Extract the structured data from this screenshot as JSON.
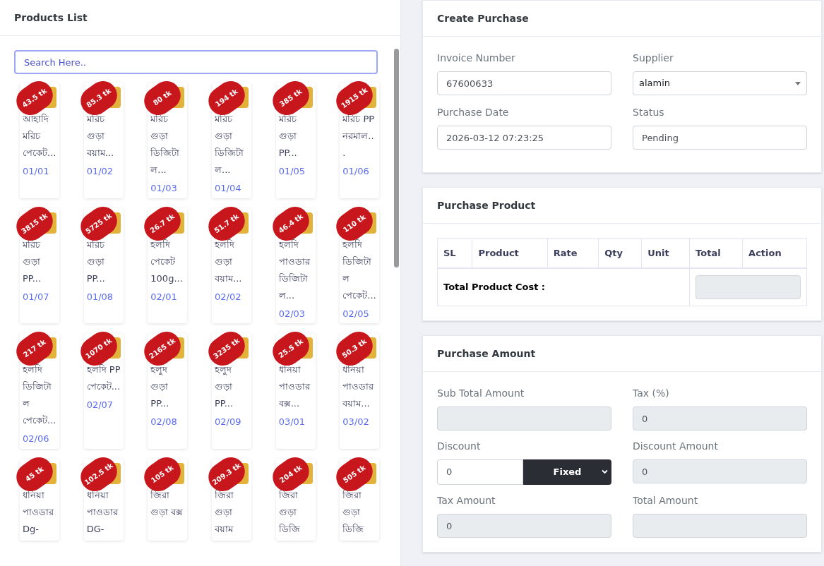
{
  "products_panel": {
    "title": "Products List",
    "search": {
      "placeholder": "Search Here.."
    },
    "products": [
      {
        "name": "আহাদি মরিচ পেকেট...",
        "price": "43.5 tk",
        "code": "01/01"
      },
      {
        "name": "মরিচ গুড়া বয়াম...",
        "price": "85.3 tk",
        "code": "01/02"
      },
      {
        "name": "মরিচ গুড়া ডিজিটাল...",
        "price": "80 tk",
        "code": "01/03"
      },
      {
        "name": "মরিচ গুড়া ডিজিটাল...",
        "price": "194 tk",
        "code": "01/04"
      },
      {
        "name": "মরিচ গুড়া PP...",
        "price": "385 tk",
        "code": "01/05"
      },
      {
        "name": "মরিচ PP নরমাল...",
        "price": "1915 tk",
        "code": "01/06"
      },
      {
        "name": "মরিচ গুড়া PP...",
        "price": "3815 tk",
        "code": "01/07"
      },
      {
        "name": "মরিচ গুড়া PP...",
        "price": "5725 tk",
        "code": "01/08"
      },
      {
        "name": "হলদি পেকেট 100g...",
        "price": "26.7 tk",
        "code": "02/01"
      },
      {
        "name": "হলদি গুড়া বয়াম...",
        "price": "51.7 tk",
        "code": "02/02"
      },
      {
        "name": "হলদি পাওডার ডিজিটাল...",
        "price": "46.4 tk",
        "code": "02/03"
      },
      {
        "name": "হলদি ডিজিটাল পেকেট...",
        "price": "110 tk",
        "code": "02/05"
      },
      {
        "name": "হলদি ডিজিটাল পেকেট...",
        "price": "217 tk",
        "code": "02/06"
      },
      {
        "name": "হলদি PP পেকেট...",
        "price": "1070 tk",
        "code": "02/07"
      },
      {
        "name": "হলুদ গুড়া PP...",
        "price": "2165 tk",
        "code": "02/08"
      },
      {
        "name": "হলুদ গুড়া PP...",
        "price": "3235 tk",
        "code": "02/09"
      },
      {
        "name": "ধনিয়া পাওডার বক্স...",
        "price": "25.5 tk",
        "code": "03/01"
      },
      {
        "name": "ধনিয়া পাওডার বয়াম...",
        "price": "50.3 tk",
        "code": "03/02"
      },
      {
        "name": "ধনিয়া পাওডার Dg-",
        "price": "45 tk"
      },
      {
        "name": "ধনিয়া পাওডার DG-",
        "price": "102.5 tk"
      },
      {
        "name": "জিরা গুড়া বক্স",
        "price": "105 tk"
      },
      {
        "name": "জিরা গুড়া বয়াম",
        "price": "209.3 tk"
      },
      {
        "name": "জিরা গুড়া ডিজি",
        "price": "204 tk"
      },
      {
        "name": "জিরা গুড়া ডিজি",
        "price": "505 tk"
      }
    ]
  },
  "create_purchase": {
    "title": "Create Purchase",
    "fields": [
      {
        "label": "Invoice Number",
        "value": "67600633",
        "kind": "input"
      },
      {
        "label": "Supplier",
        "value": "alamin",
        "kind": "select"
      },
      {
        "label": "Purchase Date",
        "value": "2026-03-12 07:23:25",
        "kind": "input"
      },
      {
        "label": "Status",
        "value": "Pending",
        "kind": "input"
      }
    ]
  },
  "purchase_product": {
    "title": "Purchase Product",
    "columns": [
      "SL",
      "Product",
      "Rate",
      "Qty",
      "Unit",
      "Total",
      "Action"
    ],
    "total_label": "Total Product Cost :"
  },
  "purchase_amount": {
    "title": "Purchase Amount",
    "fields": [
      {
        "label": "Sub Total Amount",
        "kind": "readonly"
      },
      {
        "label": "Tax (%)",
        "value": "0",
        "kind": "readonly"
      },
      {
        "label": "Discount",
        "value": "0",
        "kind": "discount",
        "type": "Fixed"
      },
      {
        "label": "Discount Amount",
        "value": "0",
        "kind": "readonly"
      },
      {
        "label": "Tax Amount",
        "value": "0",
        "kind": "readonly"
      },
      {
        "label": "Total Amount",
        "kind": "readonly"
      }
    ]
  }
}
